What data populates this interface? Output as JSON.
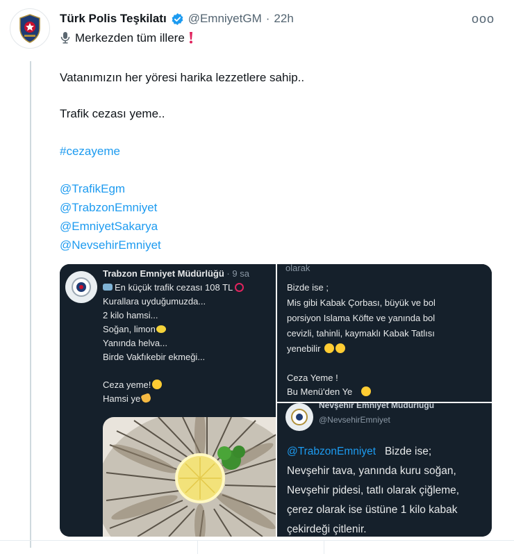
{
  "tweet": {
    "author_name": "Türk Polis Teşkilatı",
    "handle": "@EmniyetGM",
    "separator": "·",
    "time": "22h",
    "more_label": "ooo",
    "line1": "Merkezden tüm illere",
    "line2": "Vatanımızın her yöresi harika lezzetlere sahip..",
    "line3": "Trafik cezası yeme..",
    "hashtag": "#cezayeme",
    "mentions": [
      "@TrafikEgm",
      "@TrabzonEmniyet",
      "@EmniyetSakarya",
      "@NevsehirEmniyet"
    ],
    "icons": [
      "verified-badge-icon",
      "microphone-icon",
      "exclamation-icon"
    ]
  },
  "media": {
    "left": {
      "author": "Trabzon Emniyet Müdürlüğü",
      "meta": "· 9 sa",
      "lines": [
        "En küçük trafik cezası 108 TL",
        "Kurallara uyduğumuzda...",
        "2 kilo hamsi...",
        "Soğan, limon",
        "Yanında helva...",
        "Birde Vakfıkebir ekmeği...",
        "Ceza yeme!",
        "Hamsi ye"
      ]
    },
    "right_top": {
      "lines": [
        "olarak",
        "Bizde ise ;",
        "Mis gibi Kabak Çorbası, büyük ve bol",
        "porsiyon Islama Köfte  ve yanında bol",
        "cevizli, tahinli, kaymaklı Kabak Tatlısı",
        "yenebilir",
        "Ceza Yeme !",
        "Bu Menü'den Ye"
      ]
    },
    "right_bottom": {
      "author": "Nevşehir Emniyet Müdürlüğü",
      "handle": "@NevsehirEmniyet",
      "mention": "@TrabzonEmniyet",
      "lines": [
        "Bizde ise;",
        "Nevşehir tava, yanında kuru soğan,",
        "Nevşehir pidesi, tatlı olarak çiğleme,",
        "çerez olarak ise üstüne 1 kilo kabak",
        "çekirdeği çitlenir."
      ]
    }
  },
  "colors": {
    "link": "#1d9bf0",
    "dark_panel": "#15202b",
    "verified": "#1d9bf0",
    "exclamation": "#e0245e"
  }
}
